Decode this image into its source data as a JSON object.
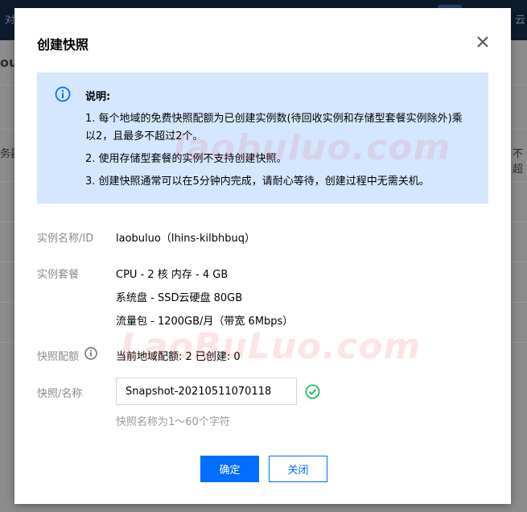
{
  "background": {
    "top_fragments": [
      "对",
      "云"
    ],
    "side_fragments": [
      "ou",
      "务器",
      "不超"
    ]
  },
  "modal": {
    "title": "创建快照",
    "close_icon": "close-icon",
    "notice": {
      "icon": "info-circle-icon",
      "title": "说明:",
      "items": [
        "1. 每个地域的免费快照配额为已创建实例数(待回收实例和存储型套餐实例除外)乘以2，且最多不超过2个。",
        "2. 使用存储型套餐的实例不支持创建快照。",
        "3. 创建快照通常可以在5分钟内完成，请耐心等待，创建过程中无需关机。"
      ]
    },
    "fields": {
      "instance": {
        "label": "实例名称/ID",
        "value": "laobuluo（lhins-kilbhbuq）"
      },
      "package": {
        "label": "实例套餐",
        "lines": [
          "CPU - 2 核 内存 - 4 GB",
          "系统盘 - SSD云硬盘 80GB",
          "流量包 - 1200GB/月（带宽 6Mbps）"
        ]
      },
      "quota": {
        "label": "快照配额",
        "icon": "info-icon",
        "value": "当前地域配额: 2 已创建: 0"
      },
      "name": {
        "label": "快照/名称",
        "value": "Snapshot-20210511070118",
        "valid_icon": "check-circle-icon",
        "hint": "快照名称为1～60个字符"
      }
    },
    "buttons": {
      "confirm": "确定",
      "cancel": "关闭"
    }
  },
  "watermark": [
    "laobuluo.com",
    "LaoBuLuo.com"
  ],
  "colors": {
    "primary": "#006eff",
    "notice_bg": "#d5e7ff",
    "success": "#0abf5b",
    "label_gray": "#888888",
    "top_bar": "#0d1b2e"
  }
}
